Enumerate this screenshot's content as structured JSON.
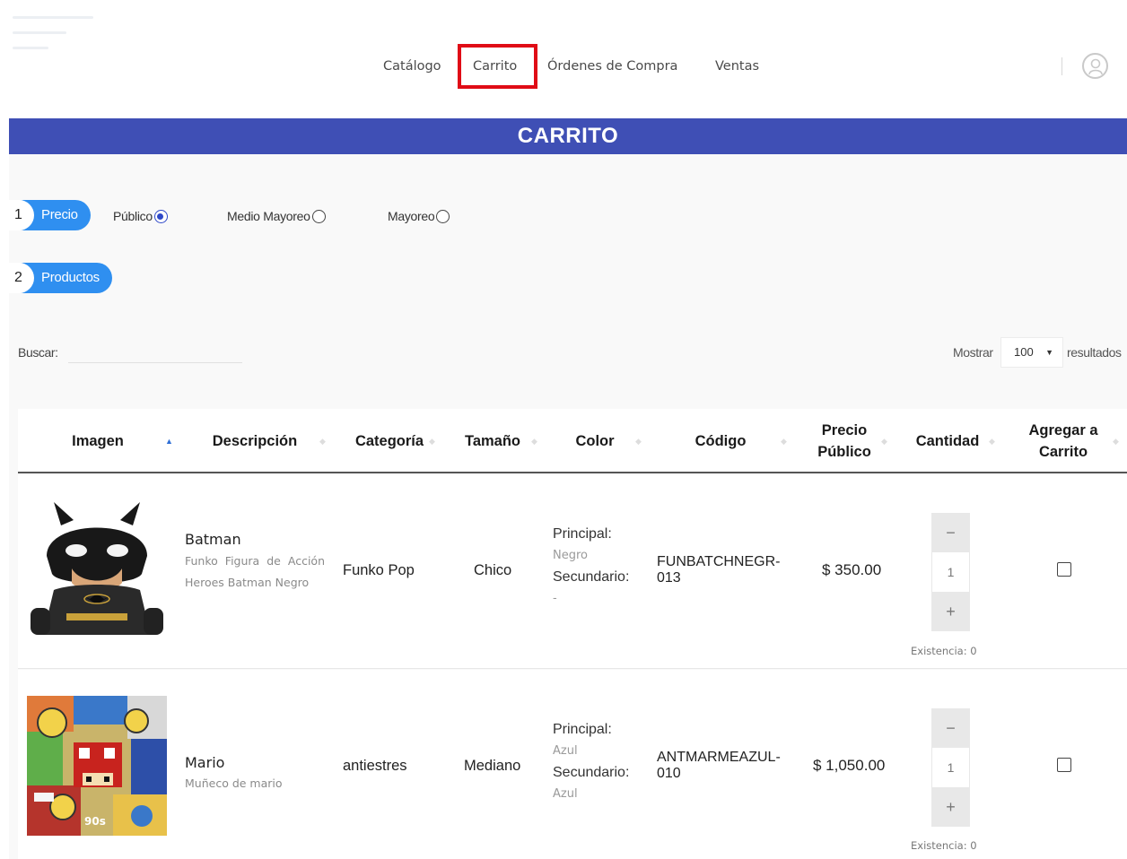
{
  "nav": {
    "items": [
      {
        "label": "Catálogo"
      },
      {
        "label": "Carrito"
      },
      {
        "label": "Órdenes de Compra"
      },
      {
        "label": "Ventas"
      }
    ],
    "active": "Carrito",
    "highlight_color": "#e00c16"
  },
  "page_title": "CARRITO",
  "accent_color": "#3f4fb5",
  "steps": {
    "price": {
      "num": "1",
      "label": "Precio"
    },
    "products": {
      "num": "2",
      "label": "Productos"
    }
  },
  "price_options": [
    {
      "label": "Público",
      "checked": true
    },
    {
      "label": "Medio Mayoreo",
      "checked": false
    },
    {
      "label": "Mayoreo",
      "checked": false
    }
  ],
  "search": {
    "label": "Buscar:",
    "value": ""
  },
  "page_size": {
    "label_before": "Mostrar",
    "value": "100",
    "label_after": "resultados"
  },
  "table": {
    "headers": {
      "image": "Imagen",
      "description": "Descripción",
      "category": "Categoría",
      "size": "Tamaño",
      "color": "Color",
      "code": "Código",
      "price_line1": "Precio",
      "price_line2": "Público",
      "quantity": "Cantidad",
      "add_line1": "Agregar a",
      "add_line2": "Carrito"
    },
    "sorted_by": "Imagen",
    "rows": [
      {
        "image": "batman-funko-image",
        "title": "Batman",
        "subtitle": "Funko Figura de Acción Heroes Batman Negro",
        "category": "Funko Pop",
        "size": "Chico",
        "primary_label": "Principal:",
        "primary_color": "Negro",
        "secondary_label": "Secundario:",
        "secondary_color": "-",
        "code_line1": "FUNBATCHNEGR-",
        "code_line2": "013",
        "price": "$ 350.00",
        "quantity": "1",
        "minus": "−",
        "plus": "+",
        "stock": "Existencia: 0",
        "added": false
      },
      {
        "image": "mario-stressball-image",
        "title": "Mario",
        "subtitle": "Muñeco de mario",
        "category": "antiestres",
        "size": "Mediano",
        "primary_label": "Principal:",
        "primary_color": "Azul",
        "secondary_label": "Secundario:",
        "secondary_color": "Azul",
        "code_line1": "ANTMARMEAZUL-",
        "code_line2": "010",
        "price": "$ 1,050.00",
        "quantity": "1",
        "minus": "−",
        "plus": "+",
        "stock": "Existencia: 0",
        "added": false
      }
    ]
  }
}
